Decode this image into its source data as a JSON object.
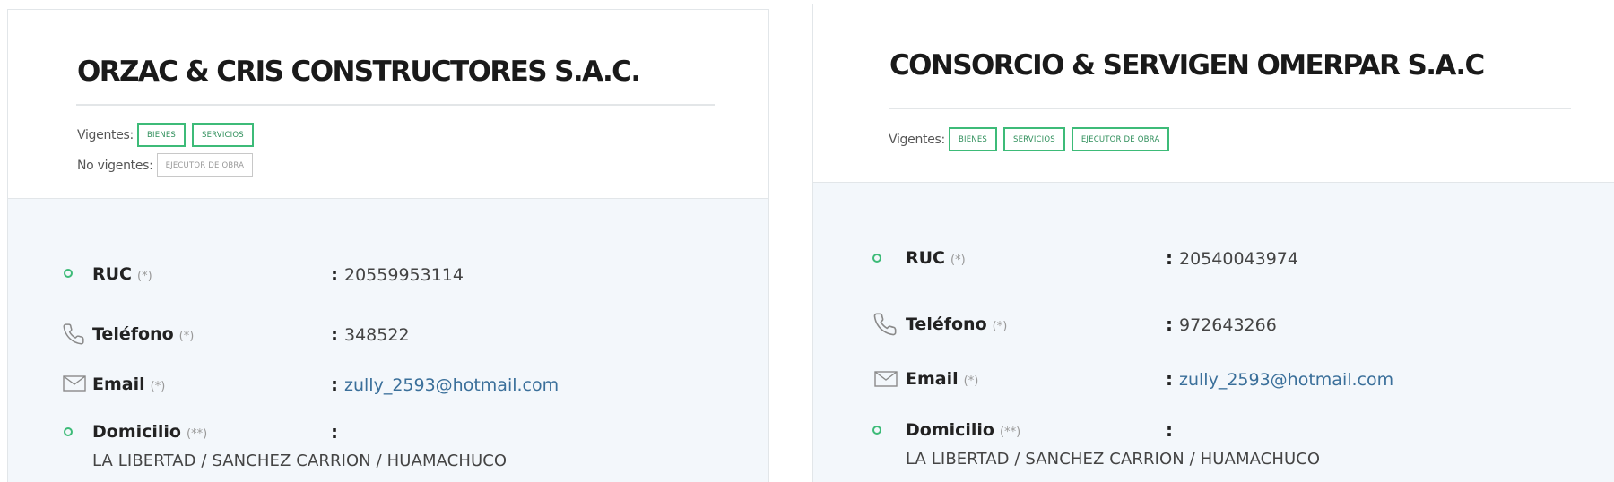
{
  "colors": {
    "accent": "#3dbb78",
    "link": "#3a6f9a",
    "panel": "#f3f7fb"
  },
  "cards": [
    {
      "name": "ORZAC & CRIS CONSTRUCTORES S.A.C.",
      "vigentes_label": "Vigentes:",
      "vigentes": [
        "BIENES",
        "SERVICIOS"
      ],
      "no_vigentes_label": "No vigentes:",
      "no_vigentes": [
        "EJECUTOR DE OBRA"
      ],
      "fields": {
        "ruc": {
          "label": "RUC",
          "req": "(*)",
          "colon": ":",
          "value": "20559953114",
          "icon": "circle-dot-icon"
        },
        "telefono": {
          "label": "Teléfono",
          "req": "(*)",
          "colon": ":",
          "value": "348522",
          "icon": "phone-icon"
        },
        "email": {
          "label": "Email",
          "req": "(*)",
          "colon": ":",
          "value": "zully_2593@hotmail.com",
          "icon": "envelope-icon"
        },
        "domicilio": {
          "label": "Domicilio",
          "req": "(**)",
          "colon": ":",
          "value": "LA LIBERTAD / SANCHEZ CARRION / HUAMACHUCO",
          "icon": "circle-dot-icon"
        }
      }
    },
    {
      "name": "CONSORCIO & SERVIGEN OMERPAR S.A.C",
      "vigentes_label": "Vigentes:",
      "vigentes": [
        "BIENES",
        "SERVICIOS",
        "EJECUTOR DE OBRA"
      ],
      "fields": {
        "ruc": {
          "label": "RUC",
          "req": "(*)",
          "colon": ":",
          "value": "20540043974",
          "icon": "circle-dot-icon"
        },
        "telefono": {
          "label": "Teléfono",
          "req": "(*)",
          "colon": ":",
          "value": "972643266",
          "icon": "phone-icon"
        },
        "email": {
          "label": "Email",
          "req": "(*)",
          "colon": ":",
          "value": "zully_2593@hotmail.com",
          "icon": "envelope-icon"
        },
        "domicilio": {
          "label": "Domicilio",
          "req": "(**)",
          "colon": ":",
          "value": "LA LIBERTAD / SANCHEZ CARRION / HUAMACHUCO",
          "icon": "circle-dot-icon"
        }
      }
    }
  ]
}
